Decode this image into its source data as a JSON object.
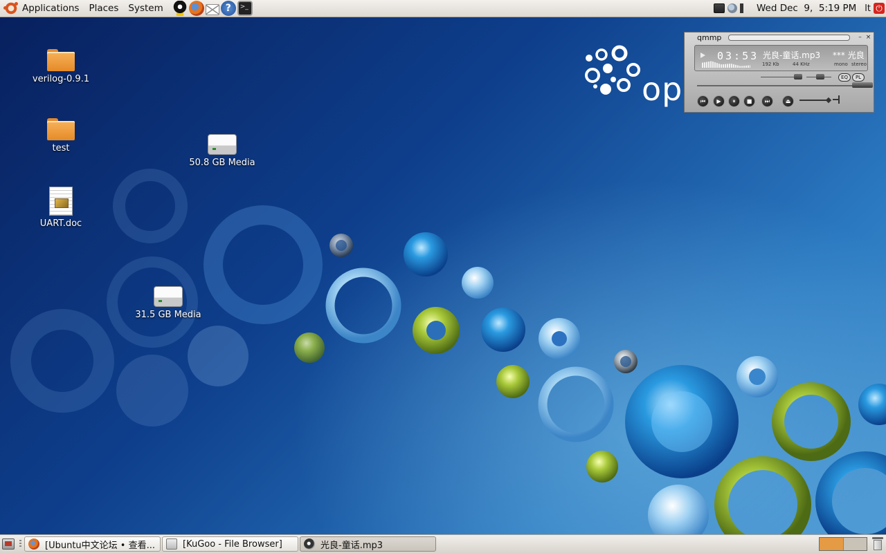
{
  "top_panel": {
    "menus": [
      {
        "label": "Applications",
        "icon": "ubuntu-logo-icon"
      },
      {
        "label": "Places"
      },
      {
        "label": "System"
      }
    ],
    "launchers": [
      {
        "name": "qq-launcher",
        "icon": "qq-penguin-icon"
      },
      {
        "name": "firefox-launcher",
        "icon": "firefox-icon"
      },
      {
        "name": "mail-launcher",
        "icon": "mail-envelope-icon"
      },
      {
        "name": "help-launcher",
        "icon": "help-question-icon",
        "glyph": "?"
      },
      {
        "name": "terminal-launcher",
        "icon": "terminal-icon",
        "glyph": ">_"
      }
    ],
    "tray": [
      "network-icon",
      "update-notifier-icon",
      "volume-icon"
    ],
    "clock": "Wed Dec  9,  5:19 PM",
    "keyboard_layout": "lt",
    "power_icon": "power-button-icon"
  },
  "desktop": {
    "icons": [
      {
        "label": "verilog-0.9.1",
        "type": "folder-icon"
      },
      {
        "label": "test",
        "type": "folder-icon"
      },
      {
        "label": "UART.doc",
        "type": "document-icon"
      },
      {
        "label": "50.8 GB Media",
        "type": "drive-icon"
      },
      {
        "label": "31.5 GB Media",
        "type": "drive-icon"
      }
    ],
    "wallpaper_logo_text": "ope",
    "colors": {
      "wallpaper_dark": "#08205e",
      "wallpaper_light": "#4a97d3",
      "bubble_green": "#a9c93a"
    }
  },
  "qmmp": {
    "title": "qmmp",
    "time": "03:53",
    "song": "光良-童话.mp3",
    "scroll_text": "*** 光良",
    "bitrate": "192 Kb",
    "samplerate": "44 KHz",
    "mono": "mono",
    "stereo": "stereo",
    "eq_label": "EQ",
    "pl_label": "PL",
    "titlebar_minimize": "–",
    "titlebar_close": "×",
    "controls": [
      {
        "name": "previous",
        "glyph": "⏮"
      },
      {
        "name": "play",
        "glyph": "▶"
      },
      {
        "name": "pause",
        "glyph": "⏸"
      },
      {
        "name": "stop",
        "glyph": "■"
      },
      {
        "name": "next",
        "glyph": "⏭"
      },
      {
        "name": "eject",
        "glyph": "⏏"
      }
    ]
  },
  "bottom_panel": {
    "tasks": [
      {
        "label": "[Ubuntu中文论坛 • 查看...",
        "icon": "firefox-icon"
      },
      {
        "label": "[KuGoo - File Browser]",
        "icon": "file-browser-icon"
      },
      {
        "label": "光良-童话.mp3",
        "icon": "media-player-icon"
      }
    ],
    "workspaces": [
      "workspace-1",
      "workspace-2"
    ],
    "trash_icon": "trash-icon"
  }
}
